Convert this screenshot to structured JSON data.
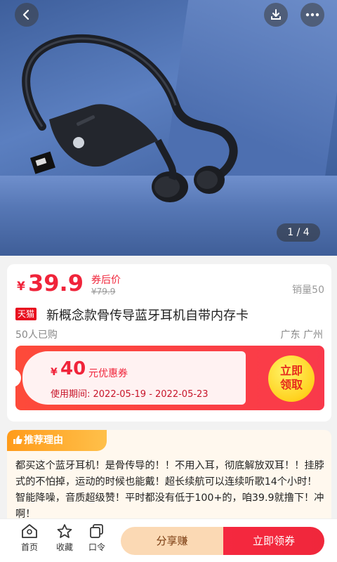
{
  "gallery": {
    "page_indicator": "1 / 4"
  },
  "product": {
    "currency": "¥",
    "price": "39.9",
    "after_coupon_label": "券后价",
    "original_price": "¥79.9",
    "sales": "销量50",
    "platform_tag": "天猫",
    "title": "新概念款骨传导蓝牙耳机自带内存卡",
    "bought_count": "50人已购",
    "location": "广东 广州"
  },
  "coupon": {
    "currency": "¥",
    "amount": "40",
    "label": "元优惠券",
    "dates": "使用期间: 2022-05-19 - 2022-05-23",
    "claim_label_line1": "立即",
    "claim_label_line2": "领取"
  },
  "reason": {
    "header": "推荐理由",
    "text": "都买这个蓝牙耳机！是骨传导的！！不用入耳，彻底解放双耳！！挂脖式的不怕掉，运动的时候也能戴！超长续航可以连续听歌14个小时！智能降噪，音质超级赞！平时都没有低于100+的，咱39.9就撸下！冲啊！"
  },
  "bottom_nav": {
    "home": "首页",
    "favorite": "收藏",
    "code": "口令",
    "share": "分享赚",
    "get_coupon": "立即领券"
  },
  "icons": {
    "back": "back-arrow-icon",
    "download": "download-icon",
    "more": "more-dots-icon",
    "home": "home-icon",
    "favorite": "star-icon",
    "code": "copy-icon",
    "thumb": "thumbs-up-icon"
  },
  "colors": {
    "accent_red": "#f0243a",
    "coupon_yellow": "#ffd21f",
    "reason_orange": "#ff9b1a",
    "share_bg": "#fbd9b4"
  }
}
